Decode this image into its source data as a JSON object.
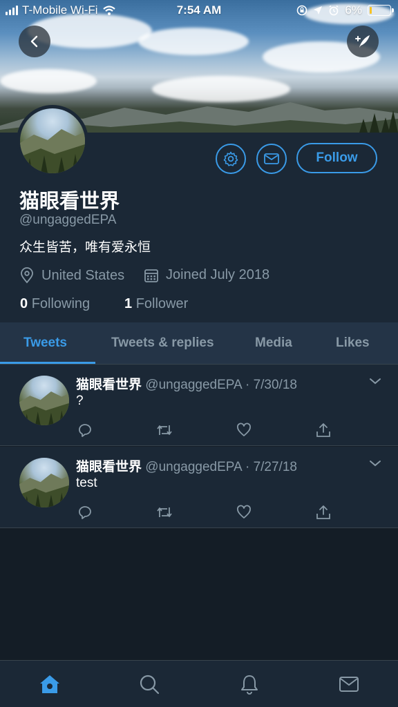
{
  "status_bar": {
    "carrier": "T-Mobile Wi-Fi",
    "time": "7:54 AM",
    "battery": "6%",
    "battery_level": 0.06
  },
  "profile": {
    "name": "猫眼看世界",
    "handle": "@ungaggedEPA",
    "bio": "众生皆苦，唯有爱永恒",
    "location": "United States",
    "joined": "Joined July 2018",
    "following_count": "0",
    "following_label": "Following",
    "followers_count": "1",
    "followers_label": "Follower",
    "follow_button": "Follow"
  },
  "tabs": [
    {
      "label": "Tweets",
      "active": true
    },
    {
      "label": "Tweets & replies",
      "active": false
    },
    {
      "label": "Media",
      "active": false
    },
    {
      "label": "Likes",
      "active": false
    }
  ],
  "tweets": [
    {
      "name": "猫眼看世界",
      "meta": "@ungaggedEPA · 7/30/18",
      "text": "?"
    },
    {
      "name": "猫眼看世界",
      "meta": "@ungaggedEPA · 7/27/18",
      "text": "test"
    }
  ],
  "colors": {
    "accent": "#3a9be8",
    "background": "#141d26",
    "card": "#1b2836",
    "secondary_text": "#8899a6"
  },
  "icons": {
    "back": "chevron-left-icon",
    "compose": "compose-tweet-icon",
    "settings": "gear-icon",
    "message": "envelope-icon",
    "location": "location-pin-icon",
    "calendar": "calendar-icon",
    "reply": "reply-icon",
    "retweet": "retweet-icon",
    "like": "heart-icon",
    "share": "share-icon",
    "nav_home": "home-icon",
    "nav_search": "search-icon",
    "nav_notifications": "bell-icon",
    "nav_messages": "envelope-icon"
  }
}
